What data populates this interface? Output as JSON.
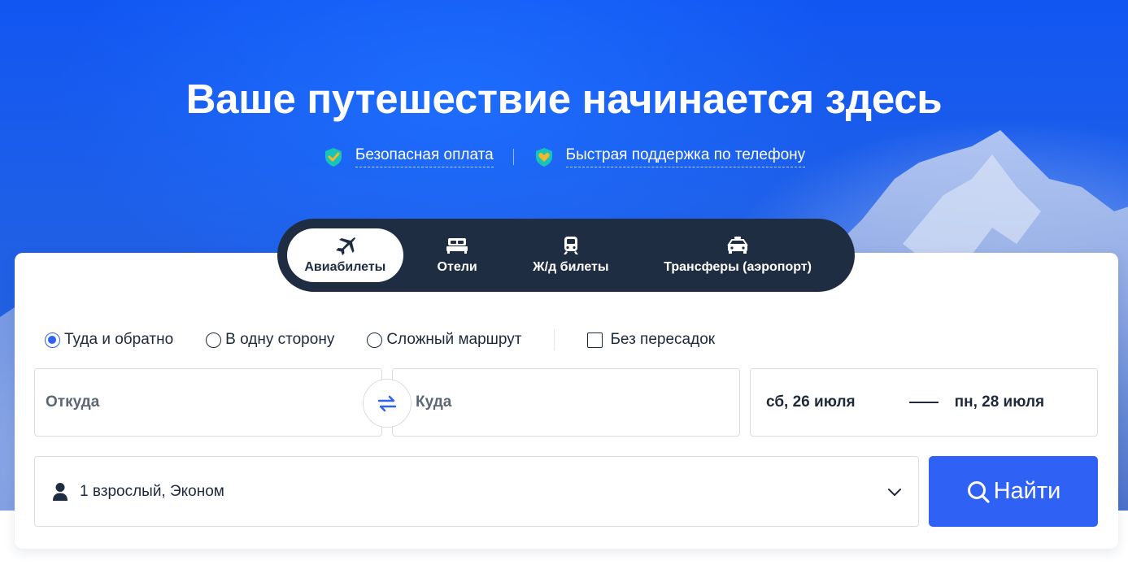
{
  "hero": {
    "headline": "Ваше путешествие начинается здесь",
    "features": [
      {
        "label": "Безопасная оплата",
        "icon": "shield-check-icon"
      },
      {
        "label": "Быстрая поддержка по телефону",
        "icon": "shield-heart-icon"
      }
    ]
  },
  "tabs": [
    {
      "label": "Авиабилеты",
      "icon": "plane-icon",
      "active": true
    },
    {
      "label": "Отели",
      "icon": "bed-icon",
      "active": false
    },
    {
      "label": "Ж/д билеты",
      "icon": "train-icon",
      "active": false
    },
    {
      "label": "Трансферы (аэропорт)",
      "icon": "car-icon",
      "active": false
    }
  ],
  "search": {
    "trip_types": [
      {
        "label": "Туда и обратно",
        "selected": true
      },
      {
        "label": "В одну сторону",
        "selected": false
      },
      {
        "label": "Сложный маршрут",
        "selected": false
      }
    ],
    "direct_only": {
      "label": "Без пересадок",
      "checked": false
    },
    "from_placeholder": "Откуда",
    "to_placeholder": "Куда",
    "depart_date": "сб, 26 июля",
    "return_date": "пн, 28 июля",
    "passengers": "1 взрослый, Эконом",
    "submit_label": "Найти"
  },
  "colors": {
    "accent": "#2f61f5",
    "tabs_bg": "#1f2d43",
    "hero_blue": "#1156f2"
  }
}
